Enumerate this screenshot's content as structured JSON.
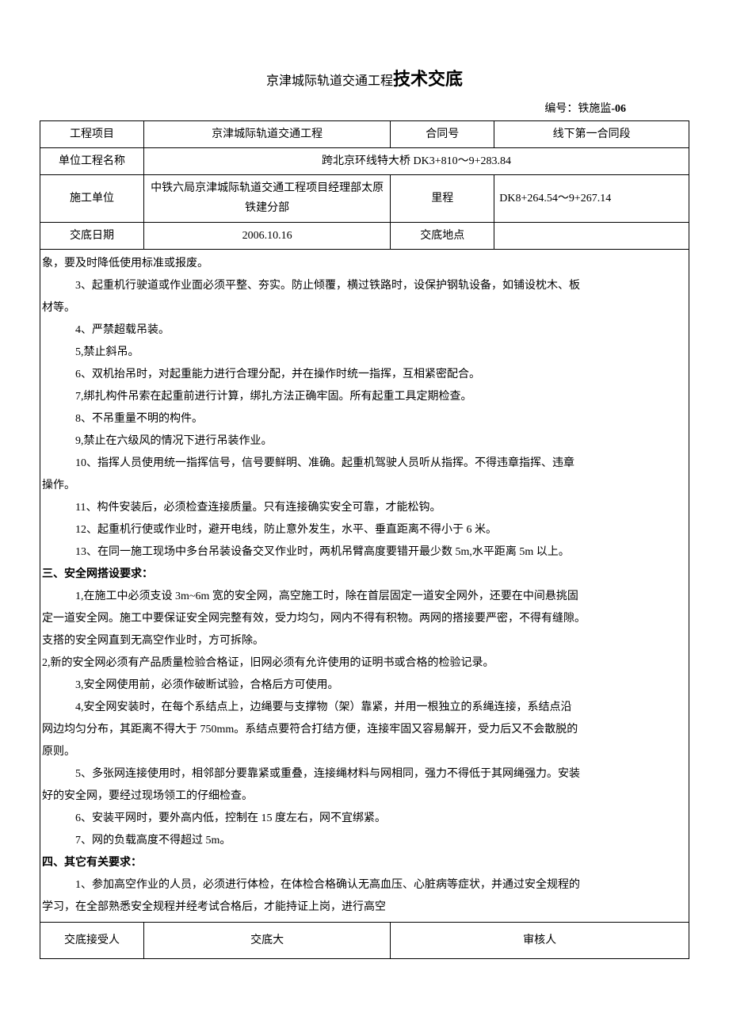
{
  "title_small": "京津城际轨道交通工程",
  "title_large": "技术交底",
  "doc_number_label": "编号：铁施监",
  "doc_number_suffix": "-06",
  "header": {
    "row1": {
      "label": "工程项目",
      "col2": "京津城际轨道交通工程",
      "col3": "合同号",
      "col4": "线下第一合同段"
    },
    "row2": {
      "label": "单位工程名称",
      "value": "跨北京环线特大桥 DK3+810～9+283.84"
    },
    "row3": {
      "label": "施工单位",
      "col2": "中铁六局京津城际轨道交通工程项目经理部太原铁建分部",
      "col3": "里程",
      "col4": "DK8+264.54～9+267.14"
    },
    "row4": {
      "label": "交底日期",
      "col2": "2006.10.16",
      "col3": "交底地点",
      "col4": ""
    }
  },
  "body": {
    "p0": "象，要及时降低使用标准或报废。",
    "p3": "3、起重机行驶道或作业面必须平整、夯实。防止倾覆，横过铁路时，设保护钢轨设备，如铺设枕木、板",
    "p3b": "材等。",
    "p4": "4、严禁超载吊装。",
    "p5": "5,禁止斜吊。",
    "p6": "6、双机抬吊时，对起重能力进行合理分配，并在操作时统一指挥，互相紧密配合。",
    "p7": "7,绑扎构件吊索在起重前进行计算，绑扎方法正确牢固。所有起重工具定期检查。",
    "p8": "8、不吊重量不明的构件。",
    "p9": "9,禁止在六级风的情况下进行吊装作业。",
    "p10": "10、指挥人员使用统一指挥信号，信号要鲜明、准确。起重机驾驶人员听从指挥。不得违章指挥、违章",
    "p10b": "操作。",
    "p11": "11、构件安装后，必须检查连接质量。只有连接确实安全可靠，才能松钩。",
    "p12": "12、起重机行使或作业时，避开电线，防止意外发生，水平、垂直距离不得小于 6 米。",
    "p13": "13、在同一施工现场中多台吊装设备交叉作业时，两机吊臂高度要错开最少数 5m,水平距离 5m 以上。",
    "sec3": "三、安全网搭设要求：",
    "s3p1": "1,在施工中必须支设 3m~6m 宽的安全网，高空施工时，除在首层固定一道安全网外，还要在中间悬挑固",
    "s3p1b": "定一道安全网。施工中要保证安全网完整有效，受力均匀，网内不得有积物。两网的搭接要严密，不得有缝隙。",
    "s3p1c": "支搭的安全网直到无高空作业时，方可拆除。",
    "s3p2": "2,新的安全网必须有产品质量检验合格证，旧网必须有允许使用的证明书或合格的检验记录。",
    "s3p3": "3,安全网使用前，必须作破断试验，合格后方可使用。",
    "s3p4": "4,安全网安装时，在每个系结点上，边绳要与支撑物（架）靠紧，并用一根独立的系绳连接，系结点沿",
    "s3p4b": "网边均匀分布，其距离不得大于 750mm。系结点要符合打结方便，连接牢固又容易解开，受力后又不会散脱的",
    "s3p4c": "原则。",
    "s3p5": "5、多张网连接使用时，相邻部分要靠紧或重叠，连接绳材料与网相同，强力不得低于其网绳强力。安装",
    "s3p5b": "好的安全网，要经过现场领工的仔细检查。",
    "s3p6": "6、安装平网时，要外高内低，控制在 15 度左右，网不宜绑紧。",
    "s3p7": "7、网的负载高度不得超过 5m。",
    "sec4": "四、其它有关要求：",
    "s4p1": "1、参加高空作业的人员，必须进行体检，在体检合格确认无高血压、心脏病等症状，并通过安全规程的",
    "s4p1b": "学习，在全部熟悉安全规程并经考试合格后，才能持证上岗，进行高空"
  },
  "footer": {
    "c1": "交底接受人",
    "c2": "交底大",
    "c3": "审核人"
  }
}
